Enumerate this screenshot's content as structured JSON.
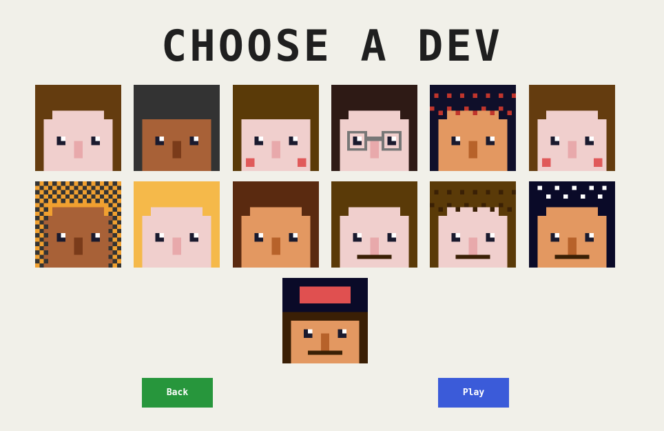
{
  "title": "CHOOSE A DEV",
  "buttons": {
    "back_label": "Back",
    "play_label": "Play"
  },
  "colors": {
    "back": "#27963c",
    "play": "#3b5bd9",
    "background": "#f1f0e9"
  },
  "avatars": [
    {
      "skin": "#f0cfcd",
      "hair": "#643c0f",
      "dark": "#e8a9ab",
      "hairStyle": "plain"
    },
    {
      "skin": "#a86137",
      "hair": "#333333",
      "dark": "#7a3b1a",
      "hairStyle": "side"
    },
    {
      "skin": "#f0cfcd",
      "hair": "#5a3a08",
      "dark": "#e8a9ab",
      "hairStyle": "side",
      "cheeks": true
    },
    {
      "skin": "#f0cfcd",
      "hair": "#2e1a15",
      "dark": "#e8a9ab",
      "hairStyle": "plain",
      "glasses": true
    },
    {
      "skin": "#e39861",
      "hair": "#0f0f2a",
      "dark": "#b7622a",
      "hairStyle": "curly",
      "accent": "#c0352c"
    },
    {
      "skin": "#f0cfcd",
      "hair": "#643c0f",
      "dark": "#e8a9ab",
      "hairStyle": "long",
      "cheeks": true
    },
    {
      "skin": "#a86137",
      "hair": "#f0a030",
      "dark": "#7a3b1a",
      "hairStyle": "check",
      "accent": "#333333"
    },
    {
      "skin": "#f0cfcd",
      "hair": "#f5b94a",
      "dark": "#e8a9ab",
      "hairStyle": "plain"
    },
    {
      "skin": "#e39861",
      "hair": "#5a2a10",
      "dark": "#b7622a",
      "hairStyle": "long"
    },
    {
      "skin": "#f0cfcd",
      "hair": "#5a3a08",
      "dark": "#e8a9ab",
      "hairStyle": "plain",
      "mustache": true
    },
    {
      "skin": "#f0cfcd",
      "hair": "#5a3a08",
      "dark": "#e8a9ab",
      "hairStyle": "curly",
      "mustache": true,
      "accent": "#3a2005"
    },
    {
      "skin": "#e39861",
      "hair": "#0a0a28",
      "dark": "#b7622a",
      "hairStyle": "bandana",
      "mustache": true,
      "accent": "#ffffff"
    },
    {
      "skin": "#e39861",
      "hair": "#3a1f05",
      "dark": "#b7622a",
      "hairStyle": "hat",
      "mustache": true,
      "accent": "#e05050"
    }
  ]
}
